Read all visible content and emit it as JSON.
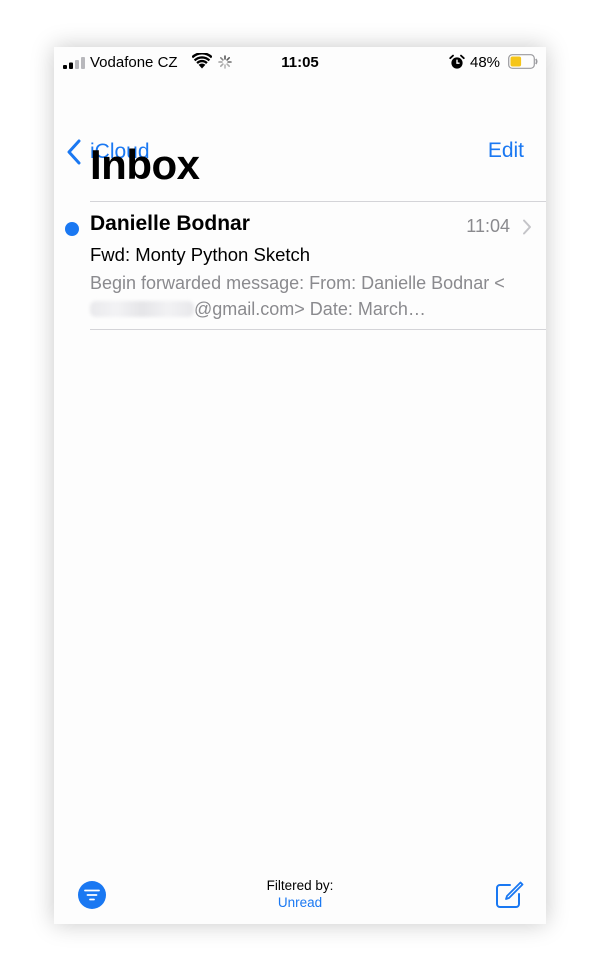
{
  "status_bar": {
    "carrier": "Vodafone CZ",
    "time": "11:05",
    "battery_percent": "48%",
    "battery_level": 0.48,
    "battery_color": "#f5c518"
  },
  "nav": {
    "back_label": "iCloud",
    "edit_label": "Edit",
    "title": "Inbox"
  },
  "messages": [
    {
      "sender": "Danielle Bodnar",
      "time": "11:04",
      "subject": "Fwd: Monty Python Sketch",
      "preview_start": "Begin forwarded message: From: Danielle Bodnar <",
      "preview_end": "@gmail.com> Date: March…",
      "unread": true
    }
  ],
  "toolbar": {
    "filtered_by_label": "Filtered by:",
    "filter_value": "Unread"
  },
  "colors": {
    "accent": "#1a78f2",
    "secondary_text": "#8a8a8e"
  },
  "icons": [
    "signal-icon",
    "wifi-icon",
    "loading-spinner-icon",
    "alarm-icon",
    "battery-icon",
    "chevron-left-icon",
    "chevron-right-icon",
    "filter-icon",
    "compose-icon"
  ]
}
